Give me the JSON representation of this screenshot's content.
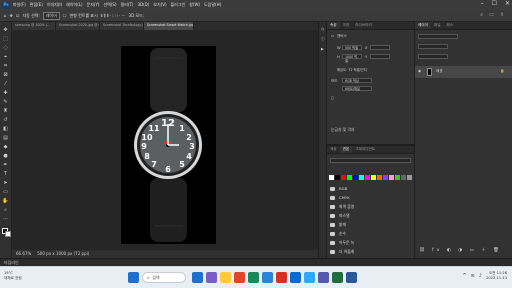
{
  "menubar": {
    "logo": "Ps",
    "items": [
      "파일(F)",
      "편집(E)",
      "이미지(I)",
      "레이어(L)",
      "문자(Y)",
      "선택(S)",
      "필터(T)",
      "3D(D)",
      "보기(V)",
      "플러그인",
      "창(W)",
      "도움말(H)"
    ],
    "controls": [
      "–",
      "☐",
      "✕"
    ]
  },
  "options": {
    "auto_select_label": "자동 선택:",
    "auto_select_value": "레이어",
    "transform_label": "변형 컨트롤 표시",
    "mode_label": "3D 모드:"
  },
  "tabs": [
    {
      "label": "samsung @ 100% (..."
    },
    {
      "label": "Screenshot 2020.jpg @ 66.7% (..."
    },
    {
      "label": "Screenshot TechNology.jpg @ 66.7% (..."
    },
    {
      "label": "Screenshot Smart Watch.jpg @ 66.7% (RGB/8#)"
    }
  ],
  "status": {
    "zoom": "66.67%",
    "doc_info": "500 px x 1000 px (72 ppi)"
  },
  "timeline": {
    "label": "타임라인"
  },
  "properties": {
    "tabs": [
      "속성",
      "조정",
      "라이브러리"
    ],
    "section_label": "캔버스",
    "width_label": "W",
    "width_value": "500 픽셀",
    "height_label": "H",
    "height_value": "1000 픽셀",
    "x_label": "X",
    "y_label": "Y",
    "resolution_text": "해상도: 72 픽셀/인치",
    "mode_label": "모드",
    "mode_value": "RGB 색상",
    "depth_value": "8비트/채널",
    "rulers_label": "눈금자 및 격자"
  },
  "libraries": {
    "tabs": [
      "색상",
      "견본",
      "그레이디언트"
    ],
    "swatch_colors": [
      "#ffffff",
      "#000000",
      "#ff0000",
      "#00ff00",
      "#0000ff",
      "#00ffff",
      "#ff00ff",
      "#ffff00",
      "#ff6600",
      "#9933ff",
      "#ff99cc",
      "#33cc33",
      "#666666",
      "#999999"
    ],
    "folders": [
      "RGB",
      "CMYK",
      "회색 음영",
      "파스텔",
      "밝게",
      "순수",
      "어두운 녹",
      "더 어둡게"
    ]
  },
  "layers": {
    "tabs": [
      "레이어",
      "채널",
      "패스"
    ],
    "layer_name": "배경"
  },
  "taskbar": {
    "weather_temp": "19°C",
    "weather_desc": "대체로 흐림",
    "search_label": "검색",
    "time": "오전 11:26",
    "date": "2022-11-13",
    "icon_colors": [
      "#1f6fd0",
      "#7a5cc7",
      "#ffc83d",
      "#e0452b",
      "#1b8a5a",
      "#2a83d8",
      "#d93025",
      "#0b6bd1",
      "#31a8ff",
      "#5558af",
      "#1d6f42",
      "#2b579a"
    ]
  }
}
